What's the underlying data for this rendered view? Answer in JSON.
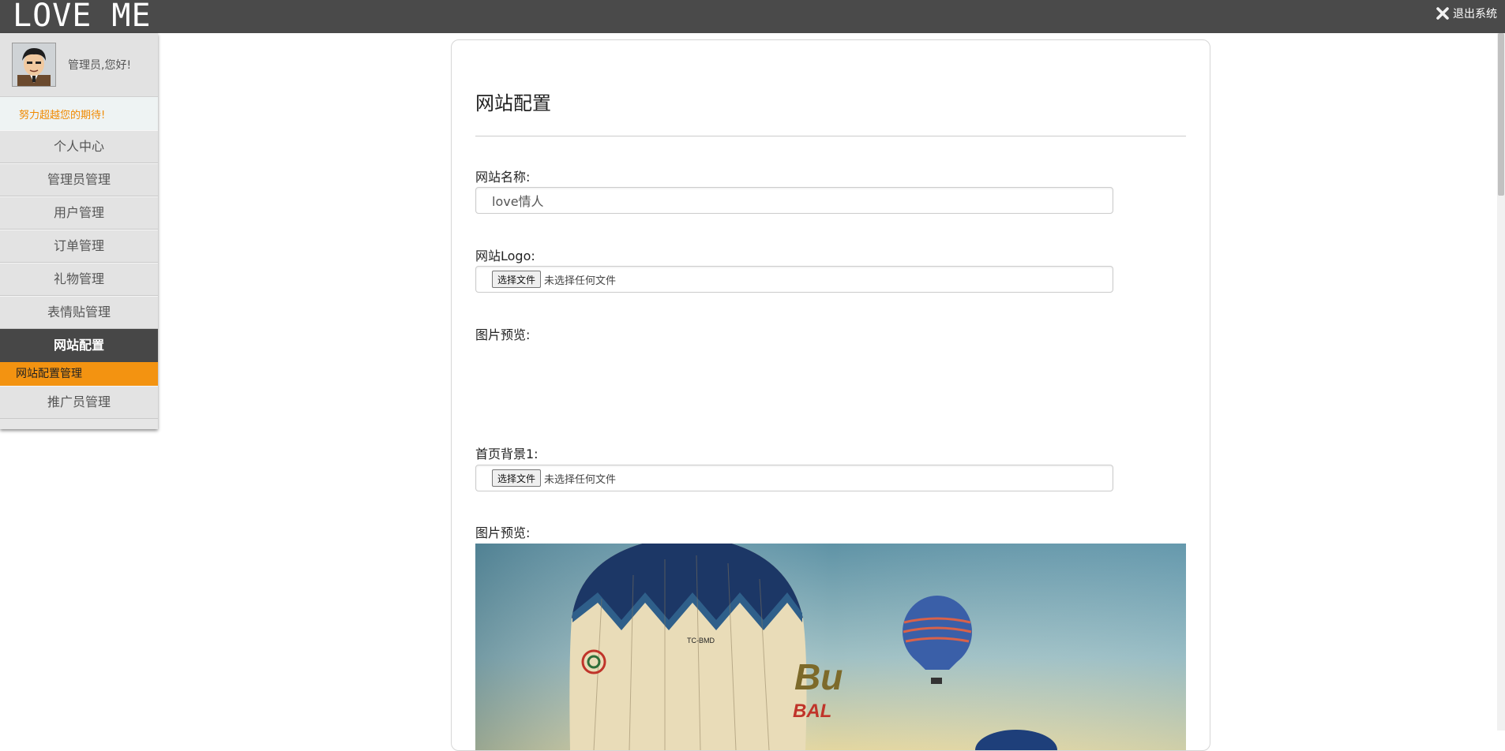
{
  "header": {
    "brand": "LOVE ME",
    "logout_label": "退出系统"
  },
  "sidebar": {
    "greeting": "管理员,您好!",
    "slogan": "努力超越您的期待!",
    "items": [
      {
        "label": "个人中心"
      },
      {
        "label": "管理员管理"
      },
      {
        "label": "用户管理"
      },
      {
        "label": "订单管理"
      },
      {
        "label": "礼物管理"
      },
      {
        "label": "表情贴管理"
      },
      {
        "label": "网站配置"
      },
      {
        "label": "推广员管理"
      }
    ],
    "active_item": "网站配置",
    "active_sub_item": "网站配置管理"
  },
  "main": {
    "title": "网站配置",
    "site_name": {
      "label": "网站名称:",
      "value": "love情人"
    },
    "site_logo": {
      "label": "网站Logo:",
      "button": "选择文件",
      "status": "未选择任何文件",
      "preview_label": "图片预览:"
    },
    "home_bg1": {
      "label": "首页背景1:",
      "button": "选择文件",
      "status": "未选择任何文件",
      "preview_label": "图片预览:",
      "preview_image": "hot-air-balloons-photo"
    }
  },
  "colors": {
    "topbar": "#4a4a4a",
    "sidebar_bg": "#e6e6e6",
    "active_nav": "#474747",
    "active_sub": "#f39311",
    "slogan_text": "#f08a00"
  }
}
